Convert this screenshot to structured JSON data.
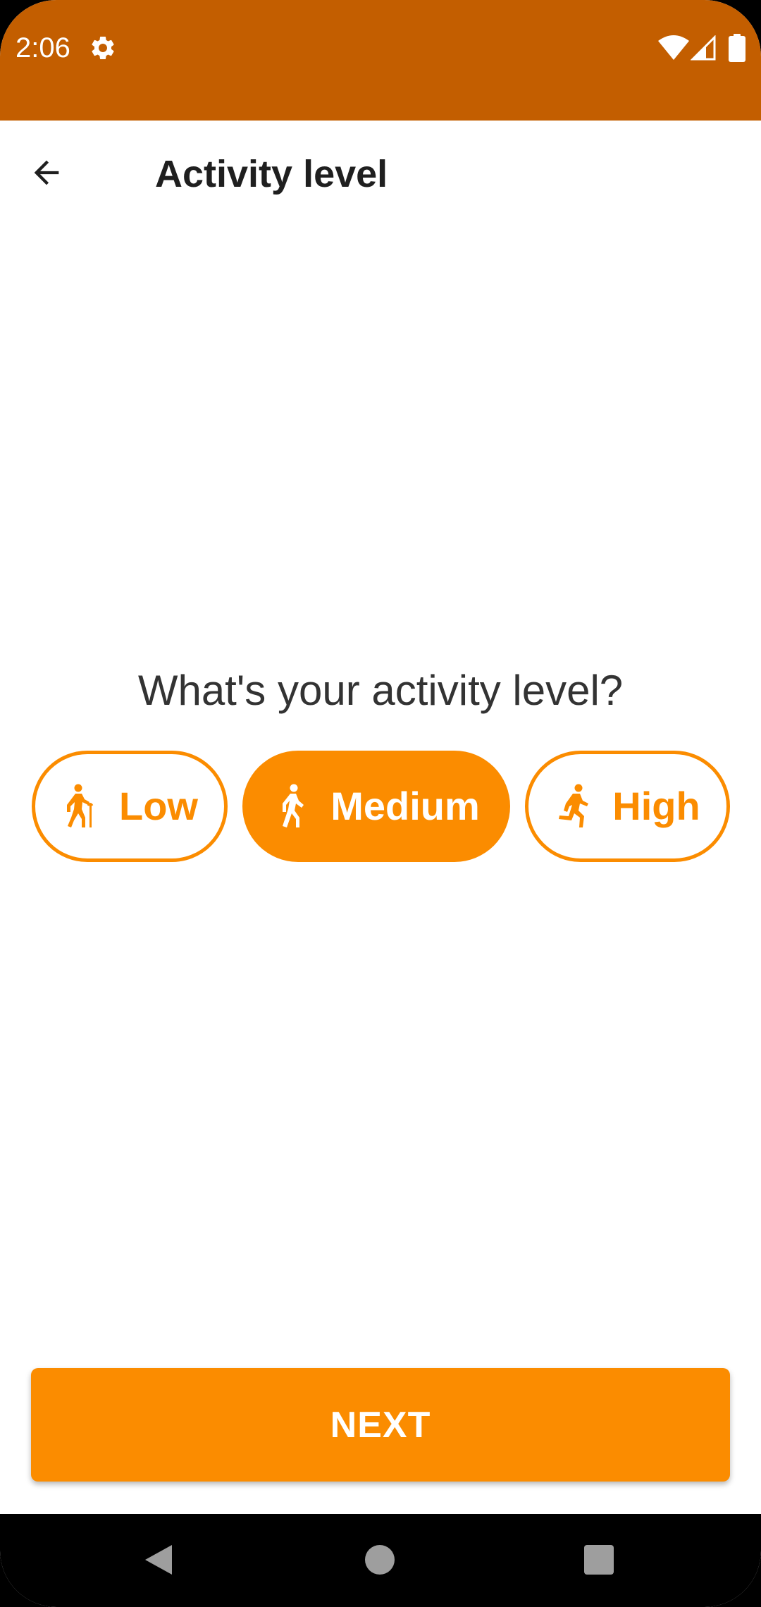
{
  "status_bar": {
    "time": "2:06",
    "background": "#c35e00",
    "icons": [
      "gear-icon",
      "wifi-icon",
      "signal-icon",
      "battery-icon"
    ]
  },
  "app_bar": {
    "title": "Activity level",
    "back_icon": "arrow-back-icon"
  },
  "main": {
    "question": "What's your activity level?",
    "options": [
      {
        "label": "Low",
        "icon": "elderly-walking-icon",
        "selected": false
      },
      {
        "label": "Medium",
        "icon": "walking-icon",
        "selected": true
      },
      {
        "label": "High",
        "icon": "running-icon",
        "selected": false
      }
    ]
  },
  "next_button": {
    "label": "NEXT"
  },
  "nav_bar": {
    "icons": [
      "nav-back-icon",
      "nav-home-icon",
      "nav-recents-icon"
    ]
  },
  "colors": {
    "accent": "#fb8c00",
    "status_bar": "#c35e00",
    "text_primary": "#1f1f1f",
    "text_secondary": "#333333"
  }
}
